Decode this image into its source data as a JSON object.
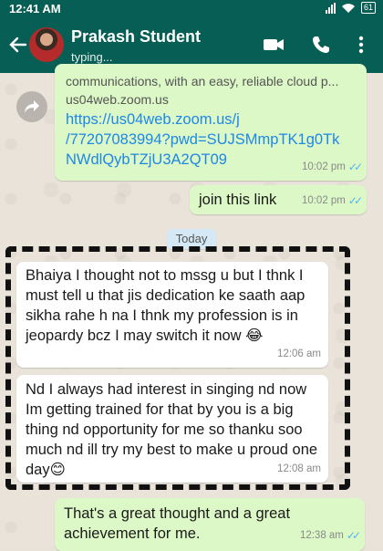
{
  "status_bar": {
    "time": "12:41 AM",
    "battery": "61"
  },
  "header": {
    "contact_name": "Prakash Student",
    "status": "typing..."
  },
  "messages": [
    {
      "direction": "out",
      "preview_line": "communications, with an easy, reliable cloud p...",
      "preview_domain": "us04web.zoom.us",
      "link_lines": [
        "https://us04web.zoom.us/j",
        "/77207083994?pwd=SUJSMmpTK1g0Tk",
        "NWdlQybTZjU3A2QT09"
      ],
      "time": "10:02 pm"
    },
    {
      "direction": "out",
      "text": "join this link",
      "time": "10:02 pm"
    },
    {
      "direction": "in",
      "text": "Bhaiya I thought not to mssg u but I thnk I must tell u that jis dedication ke saath aap sikha rahe h na I thnk my profession is in jeopardy bcz I may switch it now 😂",
      "time": "12:06 am"
    },
    {
      "direction": "in",
      "text": "Nd I always had interest in singing nd now Im getting trained for that by you is a big thing nd opportunity for me so thanku soo much nd ill try my best to make u proud one day😊",
      "time": "12:08 am"
    },
    {
      "direction": "out",
      "text": "That's a great thought and a great achievement for me.",
      "time": "12:38 am"
    }
  ],
  "date_separator": "Today",
  "colors": {
    "header": "#075e54",
    "outgoing": "#dcf8c6",
    "incoming": "#ffffff",
    "link": "#1e88e5",
    "read_ticks": "#4fb6ec"
  }
}
